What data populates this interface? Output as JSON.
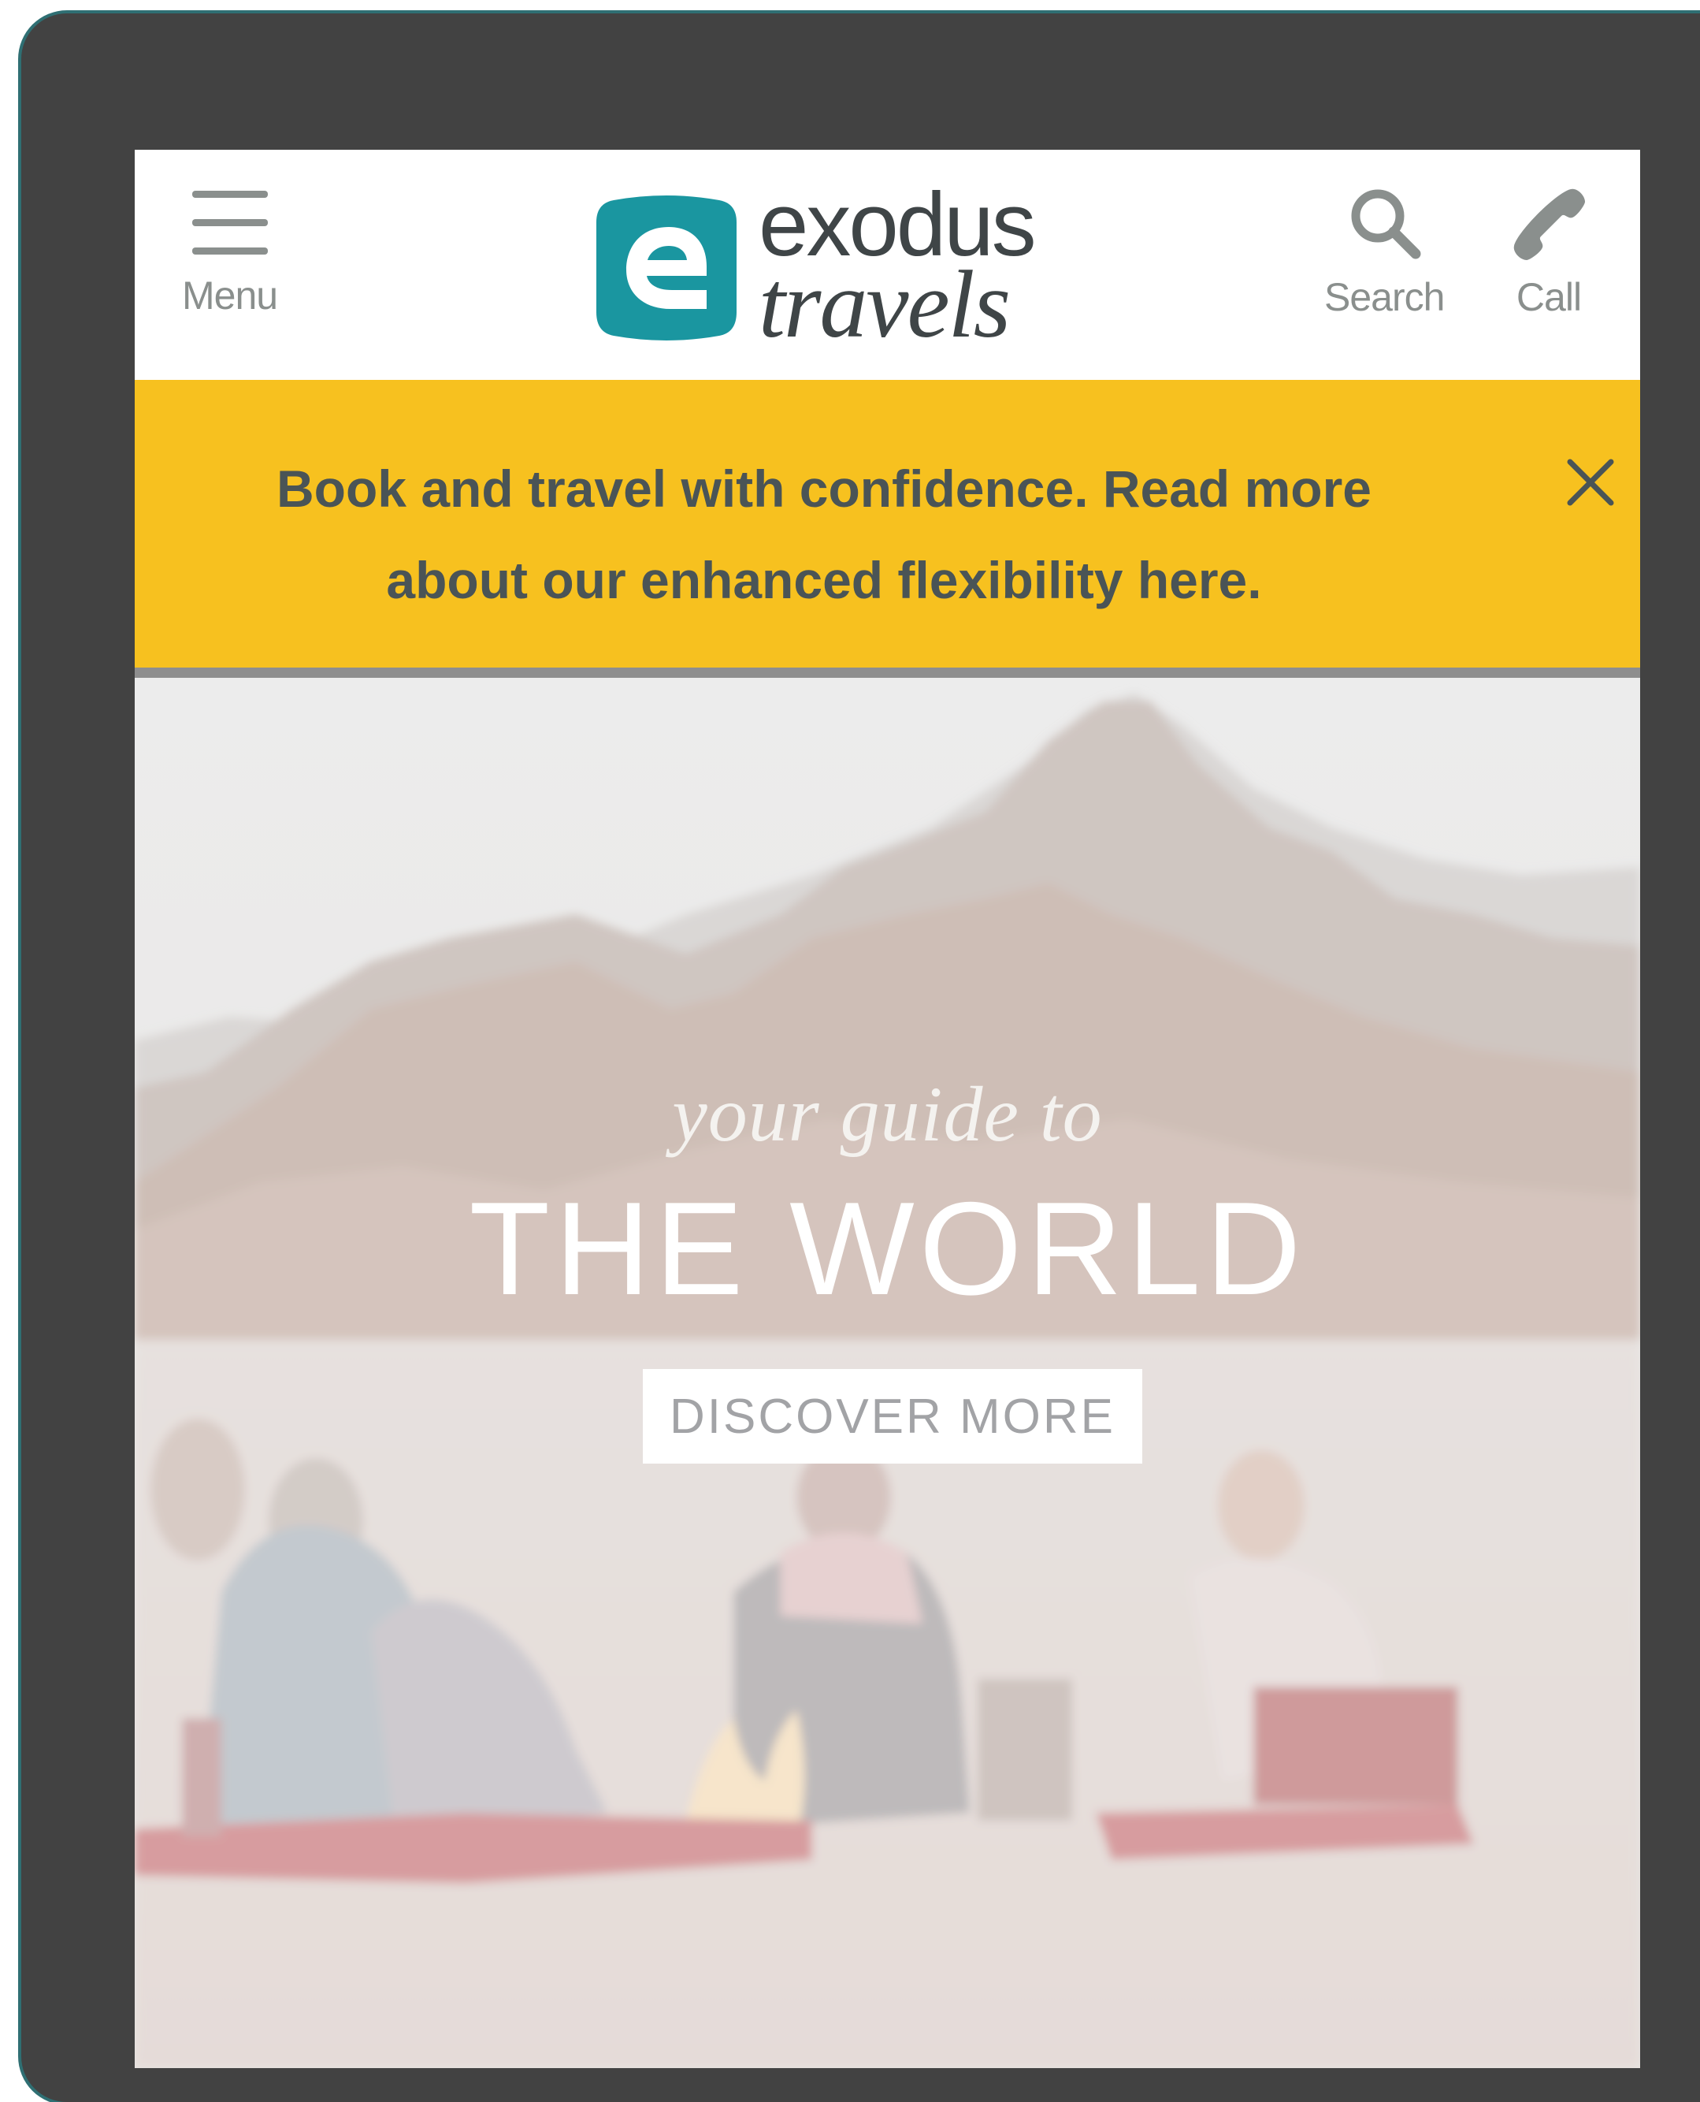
{
  "header": {
    "menu_label": "Menu",
    "search_label": "Search",
    "call_label": "Call",
    "logo": {
      "line1": "exodus",
      "line2": "travels"
    }
  },
  "banner": {
    "text": "Book and travel with confidence. Read more about our enhanced flexibility here."
  },
  "hero": {
    "tagline": "your guide to",
    "headline": "THE WORLD",
    "cta_label": "DISCOVER MORE"
  },
  "colors": {
    "brand_teal": "#1a96a0",
    "banner_yellow": "#f7c11f",
    "device_frame": "#424242",
    "text_grey": "#8a8f8d"
  }
}
